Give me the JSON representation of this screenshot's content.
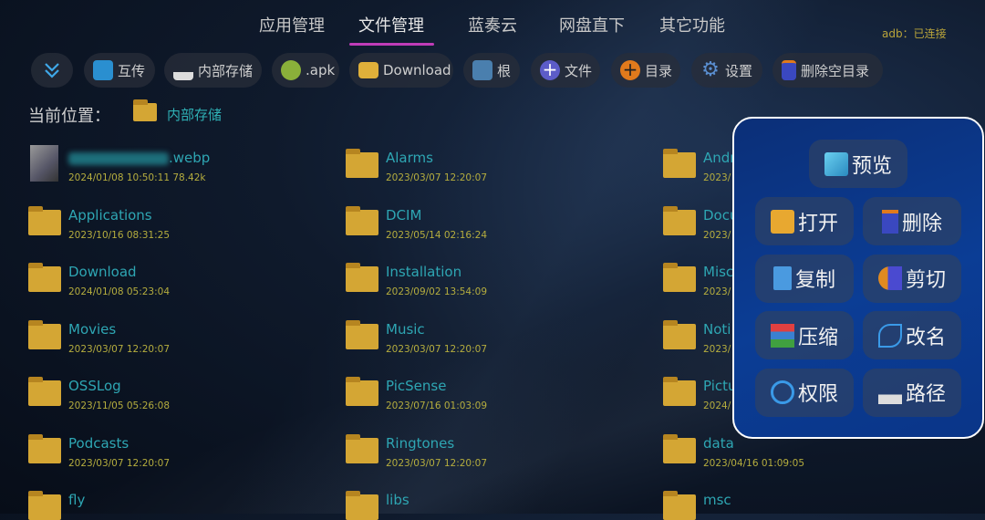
{
  "tabs": [
    {
      "label": "应用管理"
    },
    {
      "label": "文件管理",
      "active": true
    },
    {
      "label": "蓝奏云"
    },
    {
      "label": "网盘直下"
    },
    {
      "label": "其它功能"
    }
  ],
  "status": {
    "adb": "adb：已连接"
  },
  "toolbar": [
    {
      "icon": "chevron-double-down-icon",
      "label": ""
    },
    {
      "icon": "share-icon",
      "label": "互传"
    },
    {
      "icon": "storage-icon",
      "label": "内部存储"
    },
    {
      "icon": "android-icon",
      "label": ".apk"
    },
    {
      "icon": "folder-icon",
      "label": "Download"
    },
    {
      "icon": "root-icon",
      "label": "根"
    },
    {
      "icon": "plus-circle-icon",
      "label": "文件"
    },
    {
      "icon": "plus-circle-icon",
      "label": "目录"
    },
    {
      "icon": "gear-icon",
      "label": "设置"
    },
    {
      "icon": "trash-icon",
      "label": "删除空目录"
    }
  ],
  "location": {
    "label": "当前位置：",
    "path": "内部存储"
  },
  "files": [
    [
      {
        "name": ".webp",
        "date": "2024/01/08 10:50:11  78.42k",
        "thumb": true
      },
      {
        "name": "Alarms",
        "date": "2023/03/07 12:20:07"
      },
      {
        "name": "Andr",
        "date": "2023/"
      }
    ],
    [
      {
        "name": "Applications",
        "date": "2023/10/16 08:31:25"
      },
      {
        "name": "DCIM",
        "date": "2023/05/14 02:16:24"
      },
      {
        "name": "Docu",
        "date": "2023/"
      }
    ],
    [
      {
        "name": "Download",
        "date": "2024/01/08 05:23:04"
      },
      {
        "name": "Installation",
        "date": "2023/09/02 13:54:09"
      },
      {
        "name": "Misc",
        "date": "2023/"
      }
    ],
    [
      {
        "name": "Movies",
        "date": "2023/03/07 12:20:07"
      },
      {
        "name": "Music",
        "date": "2023/03/07 12:20:07"
      },
      {
        "name": "Noti",
        "date": "2023/"
      }
    ],
    [
      {
        "name": "OSSLog",
        "date": "2023/11/05 05:26:08"
      },
      {
        "name": "PicSense",
        "date": "2023/07/16 01:03:09"
      },
      {
        "name": "Pictu",
        "date": "2024/"
      }
    ],
    [
      {
        "name": "Podcasts",
        "date": "2023/03/07 12:20:07"
      },
      {
        "name": "Ringtones",
        "date": "2023/03/07 12:20:07"
      },
      {
        "name": "data",
        "date": "2023/04/16 01:09:05"
      }
    ],
    [
      {
        "name": "fly",
        "date": ""
      },
      {
        "name": "libs",
        "date": ""
      },
      {
        "name": "msc",
        "date": ""
      }
    ]
  ],
  "popup": {
    "preview": {
      "label": "预览",
      "icon": "preview-icon"
    },
    "actions": [
      {
        "label": "打开",
        "icon": "open-box-icon"
      },
      {
        "label": "删除",
        "icon": "trash-icon"
      },
      {
        "label": "复制",
        "icon": "copy-icon"
      },
      {
        "label": "剪切",
        "icon": "scissors-icon"
      },
      {
        "label": "压缩",
        "icon": "archive-icon"
      },
      {
        "label": "改名",
        "icon": "pen-icon"
      },
      {
        "label": "权限",
        "icon": "user-lock-icon"
      },
      {
        "label": "路径",
        "icon": "path-icon"
      }
    ]
  },
  "colors": {
    "accent_underline": "#c03cb8",
    "file_name": "#2ea6b3",
    "file_date": "#b5ad3e",
    "folder": "#d4a634",
    "popup_bg": "#0b3d95"
  }
}
